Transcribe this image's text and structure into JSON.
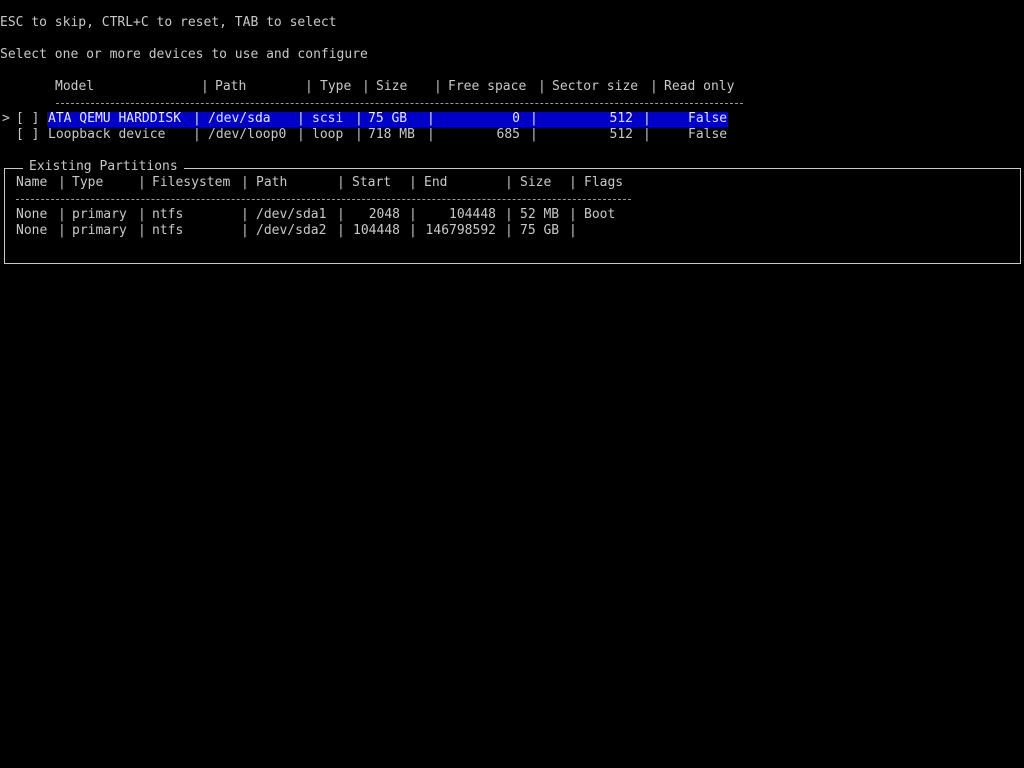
{
  "hints": "ESC to skip, CTRL+C to reset, TAB to select",
  "prompt": "Select one or more devices to use and configure",
  "device_table": {
    "headers": {
      "model": "Model",
      "path": "Path",
      "type": "Type",
      "size": "Size",
      "free_space": "Free space",
      "sector_size": "Sector size",
      "read_only": "Read only"
    },
    "rows": [
      {
        "cursor": ">",
        "checkbox": "[ ]",
        "model": "ATA QEMU HARDDISK",
        "path": "/dev/sda",
        "type": "scsi",
        "size": "75 GB",
        "free_space": "0",
        "sector_size": "512",
        "read_only": "False",
        "selected": true
      },
      {
        "cursor": "",
        "checkbox": "[ ]",
        "model": "Loopback device",
        "path": "/dev/loop0",
        "type": "loop",
        "size": "718 MB",
        "free_space": "685",
        "sector_size": "512",
        "read_only": "False",
        "selected": false
      }
    ]
  },
  "partitions": {
    "title": "Existing Partitions",
    "headers": {
      "name": "Name",
      "type": "Type",
      "filesystem": "Filesystem",
      "path": "Path",
      "start": "Start",
      "end": "End",
      "size": "Size",
      "flags": "Flags"
    },
    "rows": [
      {
        "name": "None",
        "type": "primary",
        "filesystem": "ntfs",
        "path": "/dev/sda1",
        "start": "2048",
        "end": "104448",
        "size": "52 MB",
        "flags": "Boot"
      },
      {
        "name": "None",
        "type": "primary",
        "filesystem": "ntfs",
        "path": "/dev/sda2",
        "start": "104448",
        "end": "146798592",
        "size": "75 GB",
        "flags": ""
      }
    ]
  },
  "colors": {
    "background": "#000000",
    "text": "#c8c8c8",
    "highlight": "#0000c8"
  }
}
